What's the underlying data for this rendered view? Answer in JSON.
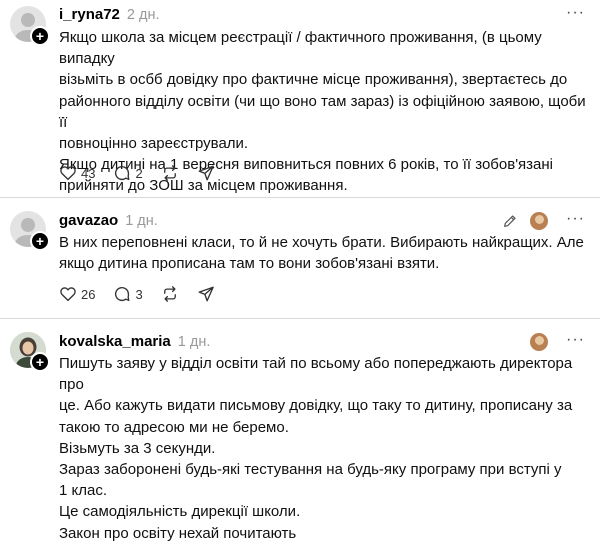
{
  "posts": [
    {
      "username": "i_ryna72",
      "time": "2 дн.",
      "lines": [
        "Якщо школа за місцем реєстрації / фактичного проживання, (в цьому випадку",
        "візьміть в осбб довідку про фактичне місце проживання), звертаєтесь до",
        "районного відділу освіти (чи що воно там зараз) із офіційною заявою, щоби її",
        "повноцінно зареєстрували.",
        "Якщо дитині на 1 вересня виповниться повних 6 років, то її зобов'язані",
        "прийняти до ЗОШ за місцем проживання."
      ],
      "likes": "43",
      "replies": "2"
    },
    {
      "username": "gavazao",
      "time": "1 дн.",
      "lines": [
        "В них переповнені класи, то й не хочуть брати. Вибирають найкращих. Але",
        "якщо дитина прописана там то вони зобов'язані взяти."
      ],
      "likes": "26",
      "replies": "3"
    },
    {
      "username": "kovalska_maria",
      "time": "1 дн.",
      "lines": [
        "Пишуть заяву у відділ освіти тай по всьому або попереджають директора про",
        "це. Або кажуть видати письмову довідку, що таку то дитину, прописану за",
        "такою то адресою ми не беремо.",
        "Візьмуть за 3 секунди.",
        "Зараз заборонені будь-які тестування на будь-яку програму при вступі у",
        "1 клас.",
        "Це самодіяльність дирекції школи.",
        "Закон про освіту нехай почитають"
      ]
    }
  ],
  "icons": {
    "more": "more-icon",
    "like": "heart-icon",
    "reply": "comment-icon",
    "repost": "repost-icon",
    "share": "send-icon",
    "edit": "pencil-icon"
  },
  "colors": {
    "time": "#999999",
    "divider": "#d9d9d9",
    "badge": "#000000"
  }
}
